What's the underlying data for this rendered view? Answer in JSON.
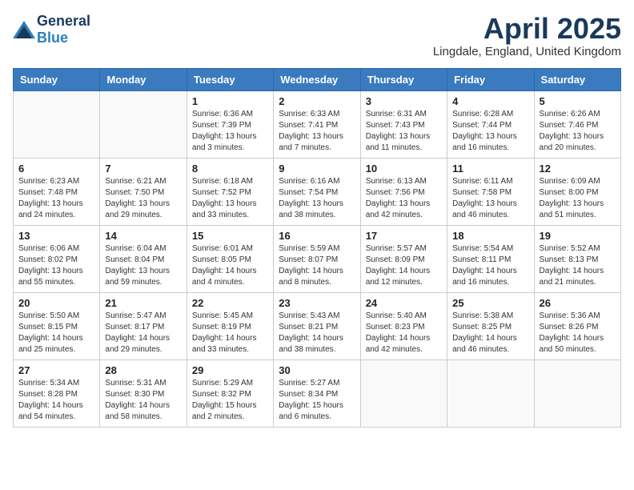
{
  "header": {
    "logo_general": "General",
    "logo_blue": "Blue",
    "month_title": "April 2025",
    "location": "Lingdale, England, United Kingdom"
  },
  "weekdays": [
    "Sunday",
    "Monday",
    "Tuesday",
    "Wednesday",
    "Thursday",
    "Friday",
    "Saturday"
  ],
  "weeks": [
    [
      {
        "day": "",
        "info": ""
      },
      {
        "day": "",
        "info": ""
      },
      {
        "day": "1",
        "info": "Sunrise: 6:36 AM\nSunset: 7:39 PM\nDaylight: 13 hours and 3 minutes."
      },
      {
        "day": "2",
        "info": "Sunrise: 6:33 AM\nSunset: 7:41 PM\nDaylight: 13 hours and 7 minutes."
      },
      {
        "day": "3",
        "info": "Sunrise: 6:31 AM\nSunset: 7:43 PM\nDaylight: 13 hours and 11 minutes."
      },
      {
        "day": "4",
        "info": "Sunrise: 6:28 AM\nSunset: 7:44 PM\nDaylight: 13 hours and 16 minutes."
      },
      {
        "day": "5",
        "info": "Sunrise: 6:26 AM\nSunset: 7:46 PM\nDaylight: 13 hours and 20 minutes."
      }
    ],
    [
      {
        "day": "6",
        "info": "Sunrise: 6:23 AM\nSunset: 7:48 PM\nDaylight: 13 hours and 24 minutes."
      },
      {
        "day": "7",
        "info": "Sunrise: 6:21 AM\nSunset: 7:50 PM\nDaylight: 13 hours and 29 minutes."
      },
      {
        "day": "8",
        "info": "Sunrise: 6:18 AM\nSunset: 7:52 PM\nDaylight: 13 hours and 33 minutes."
      },
      {
        "day": "9",
        "info": "Sunrise: 6:16 AM\nSunset: 7:54 PM\nDaylight: 13 hours and 38 minutes."
      },
      {
        "day": "10",
        "info": "Sunrise: 6:13 AM\nSunset: 7:56 PM\nDaylight: 13 hours and 42 minutes."
      },
      {
        "day": "11",
        "info": "Sunrise: 6:11 AM\nSunset: 7:58 PM\nDaylight: 13 hours and 46 minutes."
      },
      {
        "day": "12",
        "info": "Sunrise: 6:09 AM\nSunset: 8:00 PM\nDaylight: 13 hours and 51 minutes."
      }
    ],
    [
      {
        "day": "13",
        "info": "Sunrise: 6:06 AM\nSunset: 8:02 PM\nDaylight: 13 hours and 55 minutes."
      },
      {
        "day": "14",
        "info": "Sunrise: 6:04 AM\nSunset: 8:04 PM\nDaylight: 13 hours and 59 minutes."
      },
      {
        "day": "15",
        "info": "Sunrise: 6:01 AM\nSunset: 8:05 PM\nDaylight: 14 hours and 4 minutes."
      },
      {
        "day": "16",
        "info": "Sunrise: 5:59 AM\nSunset: 8:07 PM\nDaylight: 14 hours and 8 minutes."
      },
      {
        "day": "17",
        "info": "Sunrise: 5:57 AM\nSunset: 8:09 PM\nDaylight: 14 hours and 12 minutes."
      },
      {
        "day": "18",
        "info": "Sunrise: 5:54 AM\nSunset: 8:11 PM\nDaylight: 14 hours and 16 minutes."
      },
      {
        "day": "19",
        "info": "Sunrise: 5:52 AM\nSunset: 8:13 PM\nDaylight: 14 hours and 21 minutes."
      }
    ],
    [
      {
        "day": "20",
        "info": "Sunrise: 5:50 AM\nSunset: 8:15 PM\nDaylight: 14 hours and 25 minutes."
      },
      {
        "day": "21",
        "info": "Sunrise: 5:47 AM\nSunset: 8:17 PM\nDaylight: 14 hours and 29 minutes."
      },
      {
        "day": "22",
        "info": "Sunrise: 5:45 AM\nSunset: 8:19 PM\nDaylight: 14 hours and 33 minutes."
      },
      {
        "day": "23",
        "info": "Sunrise: 5:43 AM\nSunset: 8:21 PM\nDaylight: 14 hours and 38 minutes."
      },
      {
        "day": "24",
        "info": "Sunrise: 5:40 AM\nSunset: 8:23 PM\nDaylight: 14 hours and 42 minutes."
      },
      {
        "day": "25",
        "info": "Sunrise: 5:38 AM\nSunset: 8:25 PM\nDaylight: 14 hours and 46 minutes."
      },
      {
        "day": "26",
        "info": "Sunrise: 5:36 AM\nSunset: 8:26 PM\nDaylight: 14 hours and 50 minutes."
      }
    ],
    [
      {
        "day": "27",
        "info": "Sunrise: 5:34 AM\nSunset: 8:28 PM\nDaylight: 14 hours and 54 minutes."
      },
      {
        "day": "28",
        "info": "Sunrise: 5:31 AM\nSunset: 8:30 PM\nDaylight: 14 hours and 58 minutes."
      },
      {
        "day": "29",
        "info": "Sunrise: 5:29 AM\nSunset: 8:32 PM\nDaylight: 15 hours and 2 minutes."
      },
      {
        "day": "30",
        "info": "Sunrise: 5:27 AM\nSunset: 8:34 PM\nDaylight: 15 hours and 6 minutes."
      },
      {
        "day": "",
        "info": ""
      },
      {
        "day": "",
        "info": ""
      },
      {
        "day": "",
        "info": ""
      }
    ]
  ]
}
